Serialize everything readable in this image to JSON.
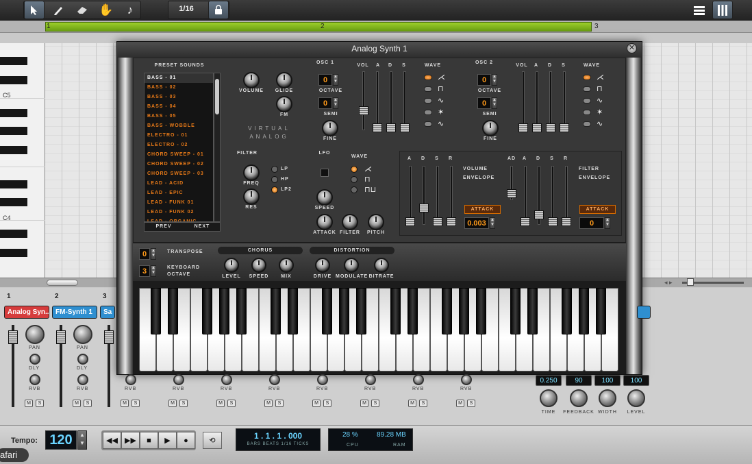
{
  "toolbar": {
    "tools": [
      "pointer-icon",
      "pencil-icon",
      "eraser-icon",
      "hand-icon",
      "note-icon"
    ],
    "quantize": "1/16"
  },
  "ruler": {
    "bars": [
      "1",
      "2",
      "3"
    ]
  },
  "piano_labels": [
    "C5",
    "C4"
  ],
  "synth": {
    "title": "Analog Synth 1",
    "preset_header": "PRESET SOUNDS",
    "presets": [
      "BASS - 01",
      "BASS - 02",
      "BASS - 03",
      "BASS - 04",
      "BASS - 05",
      "BASS - WOBBLE",
      "ELECTRO - 01",
      "ELECTRO - 02",
      "CHORD SWEEP - 01",
      "CHORD SWEEP - 02",
      "CHORD SWEEP - 03",
      "LEAD - ACID",
      "LEAD - EPIC",
      "LEAD - FUNK 01",
      "LEAD - FUNK 02",
      "LEAD - ORGANIC"
    ],
    "prev": "PREV",
    "next": "NEXT",
    "volume": "VOLUME",
    "glide": "GLIDE",
    "fm": "FM",
    "brand1": "VIRTUAL",
    "brand2": "ANALOG",
    "osc1": {
      "title": "OSC 1",
      "octave_val": "0",
      "octave": "OCTAVE",
      "semi_val": "0",
      "semi": "SEMI",
      "fine": "FINE",
      "vol": "VOL",
      "a": "A",
      "d": "D",
      "s": "S",
      "wave": "WAVE"
    },
    "osc2": {
      "title": "OSC 2",
      "octave_val": "0",
      "octave": "OCTAVE",
      "semi_val": "0",
      "semi": "SEMI",
      "fine": "FINE",
      "vol": "VOL",
      "a": "A",
      "d": "D",
      "s": "S",
      "wave": "WAVE"
    },
    "filter": {
      "title": "FILTER",
      "freq": "FREQ",
      "res": "RES",
      "lp": "LP",
      "hp": "HP",
      "lp2": "LP2"
    },
    "lfo": {
      "title": "LFO",
      "wave": "WAVE",
      "speed": "SPEED",
      "attack": "ATTACK",
      "filter": "FILTER",
      "pitch": "PITCH"
    },
    "venv": {
      "a": "A",
      "d": "D",
      "s": "S",
      "r": "R",
      "label1": "VOLUME",
      "label2": "ENVELOPE",
      "attack": "ATTACK",
      "value": "0.003"
    },
    "fenv": {
      "ad": "AD",
      "a": "A",
      "d": "D",
      "s": "S",
      "r": "R",
      "label1": "FILTER",
      "label2": "ENVELOPE",
      "attack": "ATTACK",
      "value": "0"
    },
    "transpose_val": "0",
    "transpose": "TRANSPOSE",
    "kb_oct_val": "3",
    "kb1": "KEYBOARD",
    "kb2": "OCTAVE",
    "chorus": {
      "title": "CHORUS",
      "level": "LEVEL",
      "speed": "SPEED",
      "mix": "MIX"
    },
    "distortion": {
      "title": "DISTORTION",
      "drive": "DRIVE",
      "modulate": "MODULATE",
      "bitrate": "BITRATE"
    }
  },
  "mixer": {
    "channels": [
      {
        "num": "1",
        "name": "Analog Syn...",
        "color": "#d63c3c"
      },
      {
        "num": "2",
        "name": "FM-Synth 1",
        "color": "#2f8fd0"
      },
      {
        "num": "3",
        "name": "Sa",
        "color": "#2f8fd0"
      }
    ],
    "pan": "PAN",
    "dly": "DLY",
    "rvb": "RVB",
    "m": "M",
    "s": "S",
    "fx_values": [
      "0.250",
      "90",
      "100",
      "100"
    ],
    "fx_labels": [
      "TIME",
      "FEEDBACK",
      "WIDTH",
      "LEVEL"
    ]
  },
  "transport": {
    "tempo_label": "Tempo:",
    "tempo": "120",
    "position": "1 . 1 . 1 . 000",
    "position_caption": "BARS BEATS 1/16 TICKS",
    "cpu": "28 %",
    "ram": "89.28 MB",
    "cpu_label": "CPU",
    "ram_label": "RAM"
  },
  "safari": "afari"
}
